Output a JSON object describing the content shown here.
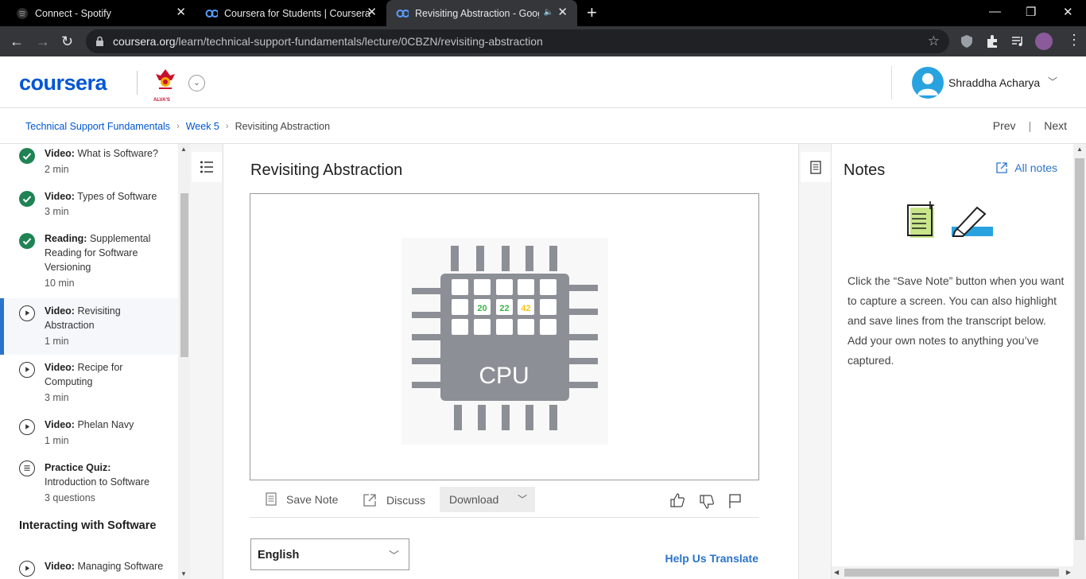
{
  "browser": {
    "tabs": [
      {
        "label": "Connect - Spotify",
        "icon": "spotify-icon"
      },
      {
        "label": "Coursera for Students | Coursera",
        "icon": "coursera-icon"
      },
      {
        "label": "Revisiting Abstraction - Goog",
        "icon": "coursera-icon",
        "active": true
      }
    ],
    "url_host": "coursera.org",
    "url_path": "/learn/technical-support-fundamentals/lecture/0CBZN/revisiting-abstraction"
  },
  "header": {
    "logo": "coursera",
    "partner_logo_text": "ALVA'S",
    "user_name": "Shraddha Acharya"
  },
  "breadcrumb": {
    "items": [
      "Technical Support Fundamentals",
      "Week 5"
    ],
    "current": "Revisiting Abstraction",
    "prev": "Prev",
    "next": "Next"
  },
  "sidebar": {
    "items": [
      {
        "type": "Video:",
        "title": "What is Software?",
        "duration": "2 min",
        "status": "done"
      },
      {
        "type": "Video:",
        "title": "Types of Software",
        "duration": "3 min",
        "status": "done"
      },
      {
        "type": "Reading:",
        "title": "Supplemental Reading for Software Versioning",
        "duration": "10 min",
        "status": "done"
      },
      {
        "type": "Video:",
        "title": "Revisiting Abstraction",
        "duration": "1 min",
        "status": "active"
      },
      {
        "type": "Video:",
        "title": "Recipe for Computing",
        "duration": "3 min",
        "status": "todo"
      },
      {
        "type": "Video:",
        "title": "Phelan Navy",
        "duration": "1 min",
        "status": "todo"
      },
      {
        "type": "Practice Quiz:",
        "title": "Introduction to Software",
        "duration": "3 questions",
        "status": "quiz"
      },
      {
        "type": "Video:",
        "title": "Managing Software",
        "duration": "",
        "status": "todo"
      }
    ],
    "section_title": "Interacting with Software"
  },
  "main": {
    "title": "Revisiting Abstraction",
    "video": {
      "cpu_label": "CPU",
      "cells": [
        "20",
        "22",
        "42"
      ]
    },
    "actions": {
      "save_note": "Save Note",
      "discuss": "Discuss",
      "download": "Download"
    },
    "language": "English",
    "help_translate": "Help Us Translate"
  },
  "notes": {
    "title": "Notes",
    "all_notes": "All notes",
    "body": "Click the “Save Note” button when you want to capture a screen. You can also highlight and save lines from the transcript below. Add your own notes to anything you’ve captured."
  },
  "colors": {
    "brand": "#0056d2",
    "link": "#2a73cc",
    "done": "#1f8354",
    "cpu_green": "#3bb54a",
    "cpu_yellow": "#f5c518"
  }
}
